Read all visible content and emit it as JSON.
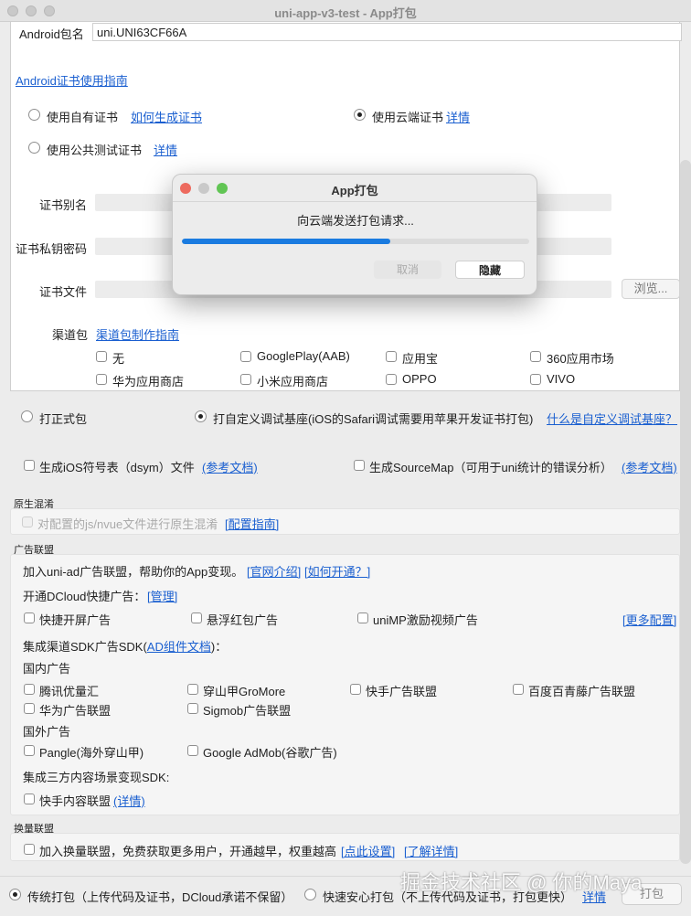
{
  "window": {
    "title": "uni-app-v3-test - App打包"
  },
  "android": {
    "package_label": "Android包名",
    "package_value": "uni.UNI63CF66A",
    "cert_guide_link": "Android证书使用指南",
    "cert_own": "使用自有证书",
    "cert_own_link": "如何生成证书",
    "cert_cloud": "使用云端证书",
    "cert_cloud_link": "详情",
    "cert_public": "使用公共测试证书",
    "cert_public_link": "详情",
    "alias_label": "证书别名",
    "key_label": "证书私钥密码",
    "file_label": "证书文件",
    "browse_button": "浏览...",
    "channel_label": "渠道包",
    "channel_link": "渠道包制作指南",
    "channels": [
      "无",
      "GooglePlay(AAB)",
      "应用宝",
      "360应用市场",
      "华为应用商店",
      "小米应用商店",
      "OPPO",
      "VIVO"
    ]
  },
  "package_type": {
    "formal": "打正式包",
    "custom": "打自定义调试基座(iOS的Safari调试需要用苹果开发证书打包)",
    "custom_link": "什么是自定义调试基座？"
  },
  "options": {
    "ios_dsym": "生成iOS符号表（dsym）文件",
    "ios_dsym_link": "(参考文档)",
    "sourcemap": "生成SourceMap（可用于uni统计的错误分析）",
    "sourcemap_link": "(参考文档)"
  },
  "native_obfuscation": {
    "section": "原生混淆",
    "label": "对配置的js/nvue文件进行原生混淆",
    "link": "[配置指南]"
  },
  "ads": {
    "section": "广告联盟",
    "join_text": "加入uni-ad广告联盟，帮助你的App变现。",
    "official_link": "[官网介绍]",
    "how_link": "[如何开通？]",
    "dcloud_text": "开通DCloud快捷广告：",
    "manage_link": "[管理]",
    "quick_options": [
      "快捷开屏广告",
      "悬浮红包广告",
      "uniMP激励视频广告"
    ],
    "more_link": "[更多配置]",
    "sdk_text": "集成渠道SDK广告SDK(",
    "sdk_link": "AD组件文档",
    "sdk_text_end": ")：",
    "domestic_label": "国内广告",
    "domestic": [
      "腾讯优量汇",
      "穿山甲GroMore",
      "快手广告联盟",
      "百度百青藤广告联盟",
      "华为广告联盟",
      "Sigmob广告联盟"
    ],
    "foreign_label": "国外广告",
    "foreign": [
      "Pangle(海外穿山甲)",
      "Google AdMob(谷歌广告)"
    ],
    "content_text": "集成三方内容场景变现SDK:",
    "content_option": "快手内容联盟",
    "content_link": "(详情)"
  },
  "exchange": {
    "section": "换量联盟",
    "label": "加入换量联盟，免费获取更多用户，开通越早，权重越高",
    "setup_link": "[点此设置]",
    "detail_link": "[了解详情]"
  },
  "bottom": {
    "traditional": "传统打包（上传代码及证书，DCloud承诺不保留）",
    "fast": "快速安心打包（不上传代码及证书，打包更快）",
    "fast_link": "详情",
    "build_button": "打包"
  },
  "watermark": "掘金技术社区 @ 你的Maya",
  "dialog": {
    "title": "App打包",
    "message": "向云端发送打包请求...",
    "progress": 0.6,
    "cancel": "取消",
    "hide": "隐藏"
  },
  "colors": {
    "link": "#1a5fd0",
    "progress": "#1a7be0",
    "close": "#ed6a5e",
    "min": "#f5bf4f",
    "max": "#61c554"
  }
}
